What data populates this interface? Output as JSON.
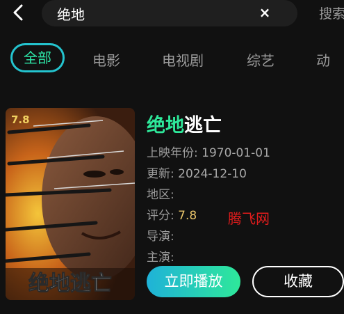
{
  "search": {
    "back_icon": "chevron-left-icon",
    "query": "绝地",
    "clear_icon": "close-icon",
    "clear_glyph": "×",
    "submit_label": "搜索"
  },
  "tabs": [
    {
      "label": "全部",
      "active": true
    },
    {
      "label": "电影",
      "active": false
    },
    {
      "label": "电视剧",
      "active": false
    },
    {
      "label": "综艺",
      "active": false
    },
    {
      "label": "动",
      "active": false
    }
  ],
  "result": {
    "title_highlight": "绝地",
    "title_rest": "逃亡",
    "poster_text": "绝地逃亡",
    "poster_rating": "7.8",
    "release_label": "上映年份:",
    "release_value": "1970-01-01",
    "update_label": "更新:",
    "update_value": "2024-12-10",
    "region_label": "地区:",
    "region_value": "",
    "score_label": "评分:",
    "score_value": "7.8",
    "director_label": "导演:",
    "director_value": "",
    "cast_label": "主演:",
    "cast_value": "",
    "play_label": "立即播放",
    "favorite_label": "收藏"
  },
  "watermark": "腾飞网",
  "colors": {
    "background": "#111111",
    "accent_green": "#2ee89a",
    "accent_cyan": "#24c4cf",
    "score": "#e8c46a",
    "watermark": "#e01c1c"
  }
}
